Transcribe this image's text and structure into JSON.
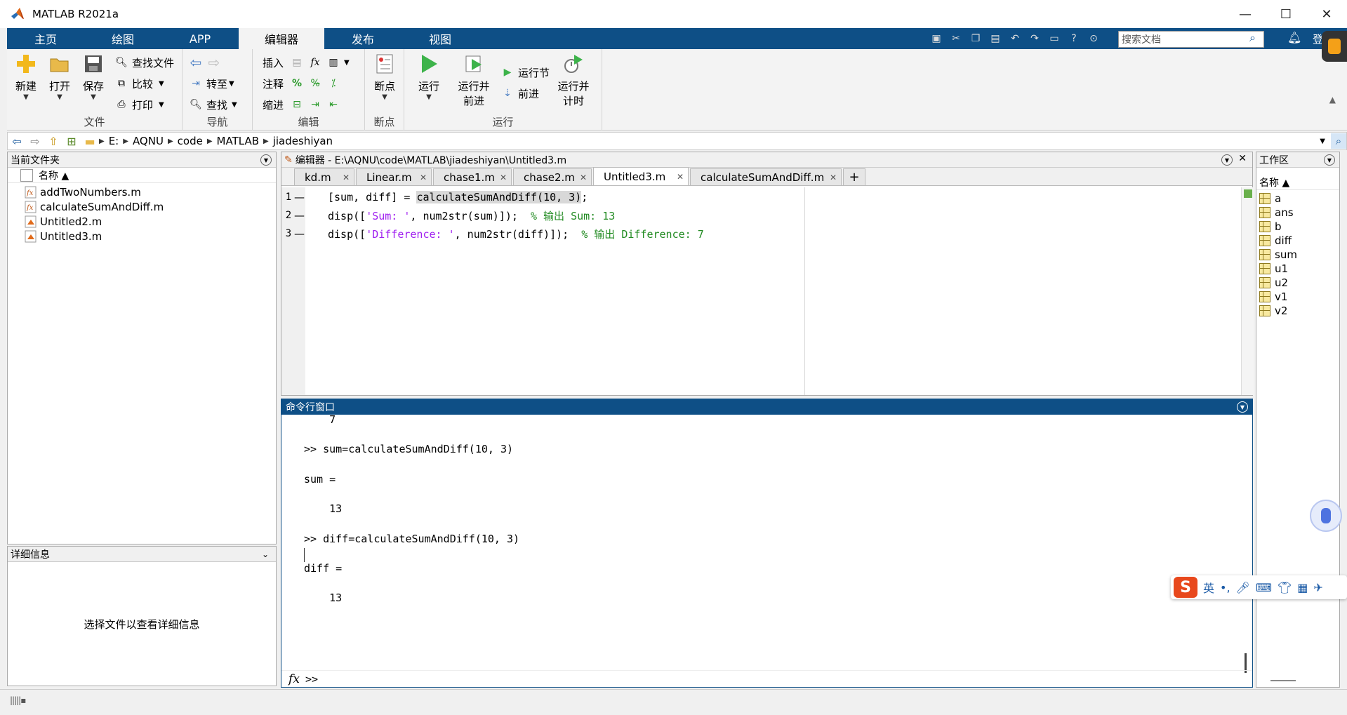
{
  "app": {
    "title": "MATLAB R2021a"
  },
  "window_controls": {
    "minimize": "—",
    "maximize": "☐",
    "close": "✕"
  },
  "tabs": [
    {
      "label": "主页"
    },
    {
      "label": "绘图"
    },
    {
      "label": "APP"
    },
    {
      "label": "编辑器",
      "active": true
    },
    {
      "label": "发布"
    },
    {
      "label": "视图"
    }
  ],
  "search": {
    "placeholder": "搜索文档"
  },
  "overflow_label": "登",
  "ribbon": {
    "file_group": {
      "label": "文件",
      "new": "新建",
      "open": "打开",
      "save": "保存",
      "find_files": "查找文件",
      "compare": "比较",
      "print": "打印"
    },
    "nav_group": {
      "label": "导航",
      "goto": "转至",
      "find": "查找"
    },
    "edit_group": {
      "label": "编辑",
      "insert": "插入",
      "comment": "注释",
      "indent": "缩进"
    },
    "breakpoints_group": {
      "label": "断点",
      "breakpoints": "断点"
    },
    "run_group": {
      "label": "运行",
      "run": "运行",
      "run_advance_1": "运行并",
      "run_advance_2": "前进",
      "run_section": "运行节",
      "advance": "前进",
      "run_time_1": "运行并",
      "run_time_2": "计时"
    }
  },
  "address": {
    "path": [
      "E:",
      "AQNU",
      "code",
      "MATLAB",
      "jiadeshiyan"
    ]
  },
  "current_folder": {
    "title": "当前文件夹",
    "column_name": "名称 ▲",
    "files": [
      "addTwoNumbers.m",
      "calculateSumAndDiff.m",
      "Untitled2.m",
      "Untitled3.m"
    ]
  },
  "details": {
    "title": "详细信息",
    "message": "选择文件以查看详细信息"
  },
  "editor": {
    "title": "编辑器 - E:\\AQNU\\code\\MATLAB\\jiadeshiyan\\Untitled3.m",
    "tabs": [
      "kd.m",
      "Linear.m",
      "chase1.m",
      "chase2.m",
      "Untitled3.m",
      "calculateSumAndDiff.m"
    ],
    "active_tab": "Untitled3.m",
    "lines": [
      {
        "num": "1",
        "pre": "[sum, diff] = ",
        "hl": "calculateSumAndDiff(10, 3)",
        "post": ";"
      },
      {
        "num": "2",
        "pre": "disp([",
        "str": "'Sum: '",
        "mid": ", num2str(sum)]);  ",
        "com": "% 输出 Sum: 13"
      },
      {
        "num": "3",
        "pre": "disp([",
        "str": "'Difference: '",
        "mid": ", num2str(diff)]);  ",
        "com": "% 输出 Difference: 7"
      }
    ]
  },
  "command_window": {
    "title": "命令行窗口",
    "output": [
      "    7",
      ">> sum=calculateSumAndDiff(10, 3)",
      "sum =",
      "    13",
      ">> diff=calculateSumAndDiff(10, 3)",
      "diff =",
      "    13"
    ],
    "prompt": ">>",
    "fx": "fx"
  },
  "workspace": {
    "title": "工作区",
    "column_name": "名称 ▲",
    "variables": [
      "a",
      "ans",
      "b",
      "diff",
      "sum",
      "u1",
      "u2",
      "v1",
      "v2"
    ]
  },
  "ime": {
    "lang": "英",
    "punct": "•,",
    "logo": "S"
  },
  "colors": {
    "accent": "#0e4f86",
    "string": "#a020f0",
    "comment": "#228b22"
  }
}
